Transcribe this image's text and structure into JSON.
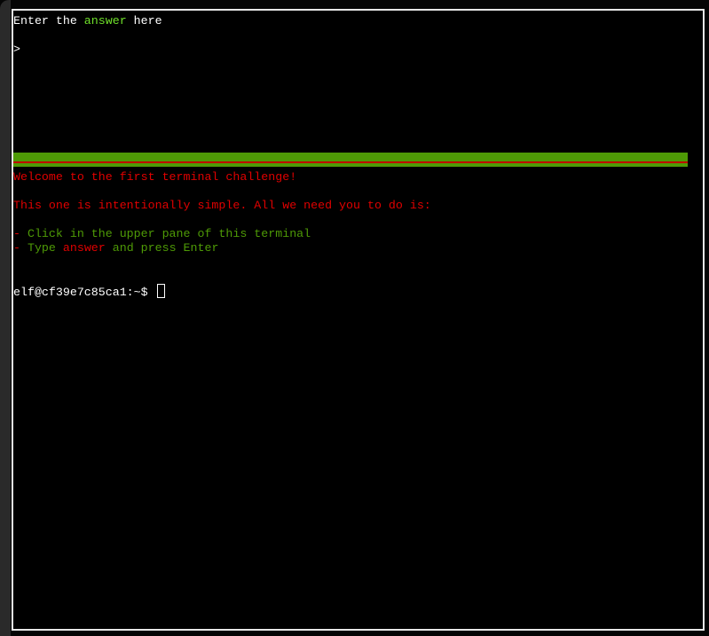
{
  "upper_pane": {
    "prompt_parts": [
      "Enter the ",
      "answer",
      " here"
    ],
    "input_prompt": ">",
    "input_value": ""
  },
  "colors": {
    "divider": "#4e9a06",
    "divider_line": "#c00000",
    "highlight": "#6fe02a",
    "message": "#e00000",
    "instructions": "#4e9a06"
  },
  "lower_pane": {
    "welcome": "Welcome to the first terminal challenge!",
    "intro": "This one is intentionally simple. All we need you to do is:",
    "steps": [
      {
        "bullet": "-",
        "parts": [
          " Click in the upper pane of this terminal"
        ]
      },
      {
        "bullet": "-",
        "parts": [
          " Type ",
          "answer",
          " and press Enter"
        ]
      }
    ],
    "shell_prompt": "elf@cf39e7c85ca1:~$ "
  }
}
